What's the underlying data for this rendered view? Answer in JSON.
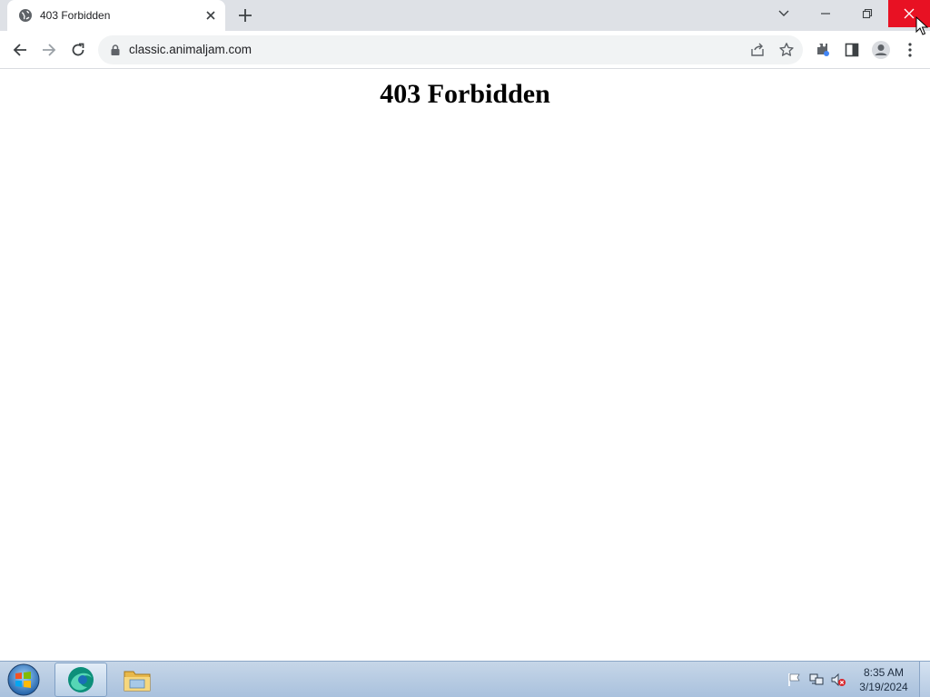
{
  "browser": {
    "tab": {
      "title": "403 Forbidden",
      "favicon": "globe-icon"
    },
    "address_bar": {
      "url": "classic.animaljam.com",
      "security_icon": "lock-icon"
    },
    "toolbar_icons": [
      "back-arrow-icon",
      "forward-arrow-icon",
      "reload-icon",
      "share-icon",
      "star-icon",
      "extensions-icon",
      "side-panel-icon",
      "profile-icon",
      "more-vert-icon"
    ],
    "window_controls": [
      "tab-search-icon",
      "minimize-icon",
      "restore-icon",
      "close-icon"
    ],
    "close_hover_color": "#e81123"
  },
  "page": {
    "heading": "403 Forbidden"
  },
  "taskbar": {
    "apps": [
      "start-orb-icon",
      "browser-app-icon",
      "file-explorer-icon"
    ],
    "tray_icons": [
      "action-center-flag-icon",
      "network-icon",
      "volume-muted-icon"
    ],
    "clock": {
      "time": "8:35 AM",
      "date": "3/19/2024"
    }
  }
}
